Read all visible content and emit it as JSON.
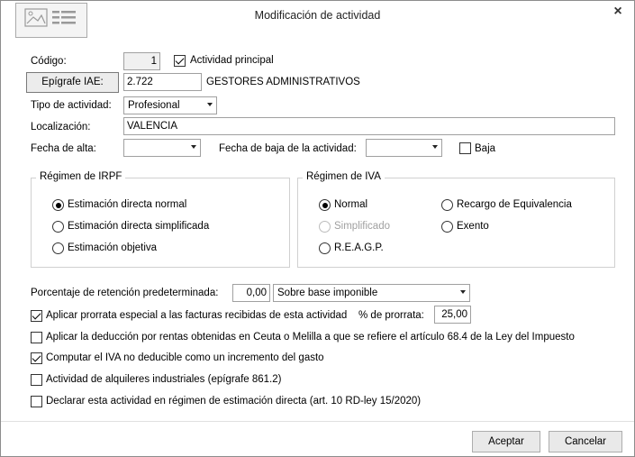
{
  "dialog": {
    "title": "Modificación de actividad",
    "close_glyph": "×"
  },
  "codigo": {
    "label": "Código:",
    "value": "1"
  },
  "actividad_principal": {
    "label": "Actividad principal",
    "checked": true
  },
  "epigrafe": {
    "button_label": "Epígrafe IAE:",
    "code": "2.722",
    "description": "GESTORES ADMINISTRATIVOS"
  },
  "tipo": {
    "label": "Tipo de actividad:",
    "value": "Profesional"
  },
  "localizacion": {
    "label": "Localización:",
    "value": "VALENCIA"
  },
  "fecha_alta": {
    "label": "Fecha de alta:",
    "value": ""
  },
  "fecha_baja": {
    "label": "Fecha de baja de la actividad:",
    "value": ""
  },
  "baja": {
    "label": "Baja",
    "checked": false
  },
  "irpf": {
    "title": "Régimen de IRPF",
    "options": [
      {
        "label": "Estimación directa normal",
        "selected": true
      },
      {
        "label": "Estimación directa simplificada",
        "selected": false
      },
      {
        "label": "Estimación objetiva",
        "selected": false
      }
    ]
  },
  "iva": {
    "title": "Régimen de IVA",
    "options": [
      {
        "label": "Normal",
        "selected": true,
        "enabled": true
      },
      {
        "label": "Simplificado",
        "selected": false,
        "enabled": false
      },
      {
        "label": "R.E.A.G.P.",
        "selected": false,
        "enabled": true
      },
      {
        "label": "Recargo de Equivalencia",
        "selected": false,
        "enabled": true
      },
      {
        "label": "Exento",
        "selected": false,
        "enabled": true
      }
    ]
  },
  "retencion": {
    "label": "Porcentaje de retención predeterminada:",
    "value": "0,00",
    "base": "Sobre base imponible"
  },
  "prorrata": {
    "label": "Aplicar prorrata especial a las facturas recibidas de esta actividad",
    "checked": true,
    "pct_label": "% de prorrata:",
    "pct_value": "25,00"
  },
  "checkboxes": [
    {
      "label": "Aplicar la deducción por rentas obtenidas en Ceuta o Melilla a que se refiere el artículo 68.4 de la Ley del Impuesto",
      "checked": false
    },
    {
      "label": "Computar el IVA no deducible como un incremento del gasto",
      "checked": true
    },
    {
      "label": "Actividad de alquileres industriales (epígrafe 861.2)",
      "checked": false
    },
    {
      "label": "Declarar esta actividad en régimen de estimación directa (art. 10 RD-ley 15/2020)",
      "checked": false
    }
  ],
  "buttons": {
    "accept": "Aceptar",
    "cancel": "Cancelar"
  },
  "icons": {
    "window": "document-card-icon",
    "close": "close-icon",
    "dropdown": "chevron-down-icon"
  }
}
